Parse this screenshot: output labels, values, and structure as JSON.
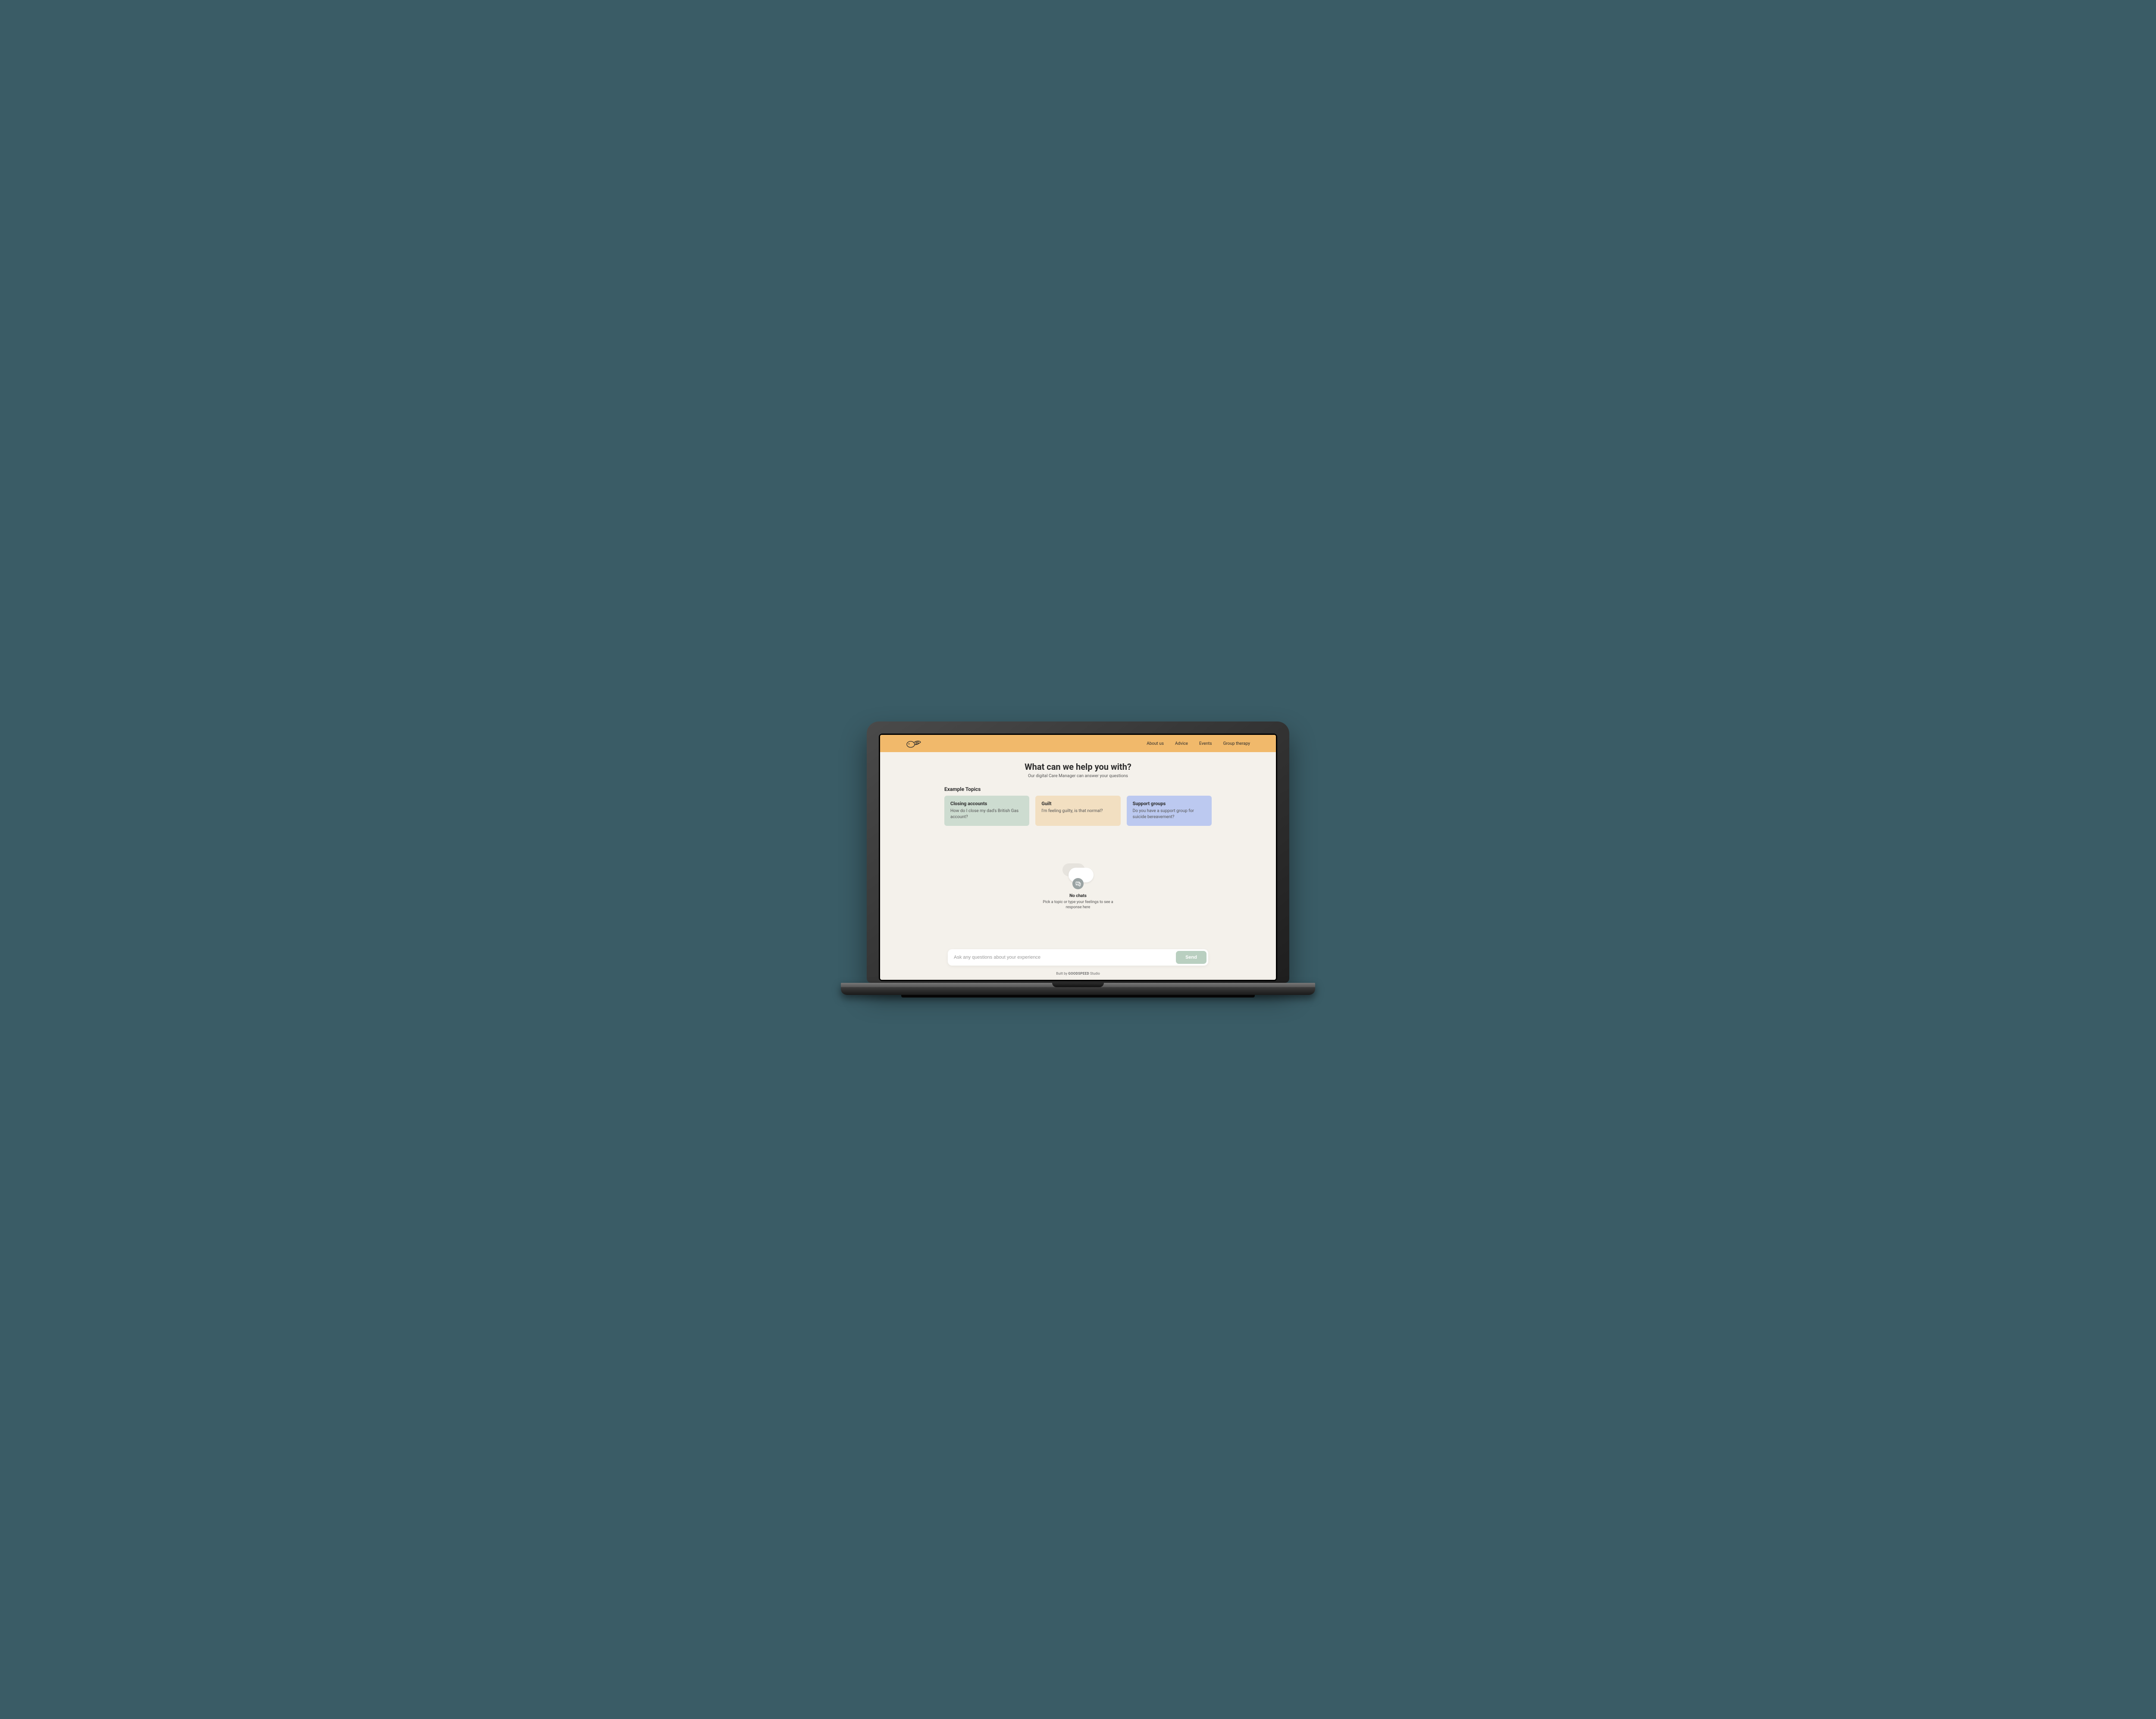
{
  "nav": {
    "items": [
      {
        "label": "About us"
      },
      {
        "label": "Advice"
      },
      {
        "label": "Events"
      },
      {
        "label": "Group therapy"
      }
    ]
  },
  "hero": {
    "title": "What can we help you with?",
    "subtitle": "Our digital Care Manager can answer your questions"
  },
  "topics": {
    "heading": "Example Topics",
    "cards": [
      {
        "title": "Closing accounts",
        "desc": "How do I close my dad's British Gas account?"
      },
      {
        "title": "Guilt",
        "desc": "I'm feeling guilty, is that normal?"
      },
      {
        "title": "Support groups",
        "desc": "Do you have a support group for suicide bereavement?"
      }
    ]
  },
  "empty": {
    "title": "No chats",
    "subtitle": "Pick a topic or type your feelings to see a response here"
  },
  "composer": {
    "placeholder": "Ask any questions about your experience",
    "send_label": "Send"
  },
  "footer": {
    "prefix": "Built by ",
    "brand": "GOODSPEED",
    "suffix": " Studio"
  },
  "colors": {
    "accent": "#f1b96b",
    "card_green": "#cddcd0",
    "card_peach": "#f2dfc1",
    "card_blue": "#bcc9f0",
    "send_btn": "#b9cfc0"
  }
}
